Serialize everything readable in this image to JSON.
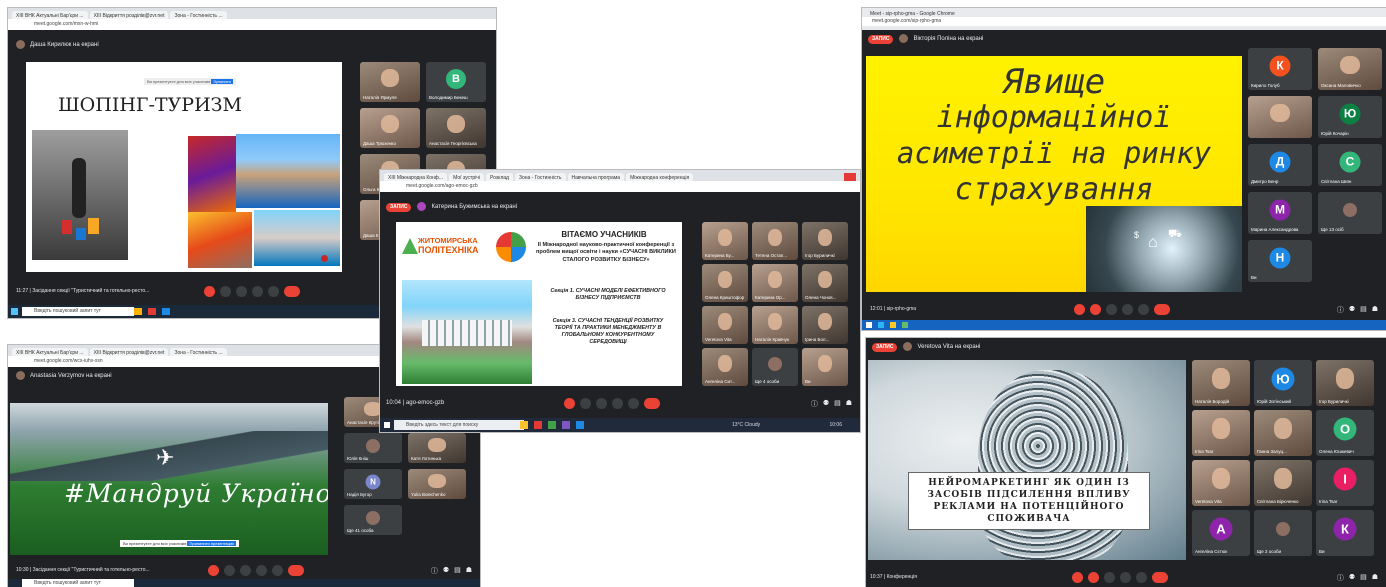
{
  "shots": {
    "s1": {
      "tabs": [
        "XIII ВНК Актуальні Бар'єри ...",
        "XIII Відкриття розділів@zvr.net",
        "Зона - Гостинність ..."
      ],
      "url": "meet.google.com/mxn-w-hmi",
      "presenter": "Даша Кирилюк на екрані",
      "slide_title": "ШОПІНГ-ТУРИЗМ",
      "slide_topbar": "Ви презентуєте для всіх учасників",
      "slide_topbtn": "Зупинити",
      "tiles": [
        {
          "name": "Наталія Ярмуля",
          "kind": "cam"
        },
        {
          "name": "Володимир Бекеш",
          "kind": "avatar",
          "letter": "B",
          "color": "#33b679"
        },
        {
          "name": "Даша Трюхенко",
          "kind": "cam2"
        },
        {
          "name": "Анастасія Георгієвська",
          "kind": "cam3"
        },
        {
          "name": "Ольга Кравчук",
          "kind": "cam"
        },
        {
          "name": "",
          "kind": "cam3"
        },
        {
          "name": "Даша К",
          "kind": "cam2"
        }
      ],
      "time_meeting": "11:27 | Засідання секції \"Туристичний та готельно-ресто...",
      "search_text": "Введіть пошуковий запит тут"
    },
    "s2": {
      "tabs": [
        "XIII ВНК Актуальні Бар'єри ...",
        "XIII Відкриття розділів@zvr.net",
        "Зона - Гостинність ..."
      ],
      "url": "meet.google.com/wcs-iuhv-xsn",
      "presenter": "Anastasia Verzymov на екрані",
      "slide_text": "#Мандруй Україною",
      "slide_topbar": "Ви презентуєте для всіх учасників",
      "slide_topbtn": "Припинити презентацію",
      "tiles": [
        {
          "name": "Анастасія Круті...",
          "kind": "cam"
        },
        {
          "name": "Ангеліна Кашпарук",
          "kind": "cam2"
        },
        {
          "name": "Юлія Кніш",
          "kind": "avatar",
          "letter": "",
          "color": "#5f6368"
        },
        {
          "name": "Катя Лотинька",
          "kind": "cam3"
        },
        {
          "name": "Надія Бугор",
          "kind": "avatar",
          "letter": "N",
          "color": "#7986cb"
        },
        {
          "name": "Yulia Boiechenko",
          "kind": "cam"
        },
        {
          "name": "Ще 41 особа",
          "kind": "avatar",
          "letter": "",
          "color": "#5f6368"
        }
      ],
      "time_meeting": "10:30 | Засідання секції \"Туристичний та готельно-ресто...",
      "search_text": "Введіть пошуковий запит тут"
    },
    "s3": {
      "tabs": [
        "XIII Міжнародна Конф...",
        "Мої зустрічі",
        "Розклад",
        "Зона - Гостинність",
        "Навчальна програма",
        "Міжнародна конференція"
      ],
      "url": "meet.google.com/ago-emoc-gzb",
      "record_label": "ЗАПИС",
      "presenter": "Катерина Бужимська на екрані",
      "slide_logo_line1": "ЖИТОМИРСЬКА",
      "slide_logo_line2": "ПОЛІТЕХНІКА",
      "slide_heading": "ВІТАЄМО УЧАСНИКІВ",
      "slide_sub": "ІІ Міжнародної науково-практичної конференції з проблем вищої освіти і науки «СУЧАСНІ ВИКЛИКИ СТАЛОГО РОЗВИТКУ БІЗНЕСУ»",
      "slide_sec1": "Секція 1. СУЧАСНІ МОДЕЛІ ЕФЕКТИВНОГО БІЗНЕСУ ПІДПРИЄМСТВ",
      "slide_sec3": "Секція 3. СУЧАСНІ ТЕНДЕНЦІЇ РОЗВИТКУ ТЕОРІЇ ТА ПРАКТИКИ МЕНЕДЖМЕНТУ В ГЛОБАЛЬНОМУ КОНКУРЕНТНОМУ СЕРЕДОВИЩІ",
      "tiles": [
        {
          "name": "Катерина Бу...",
          "kind": "cam2"
        },
        {
          "name": "Тетяна Остап...",
          "kind": "cam"
        },
        {
          "name": "Ігор Буриличкі",
          "kind": "cam3"
        },
        {
          "name": "Олена Криштофор",
          "kind": "cam"
        },
        {
          "name": "Катерина Ор...",
          "kind": "cam2"
        },
        {
          "name": "Олена Чонов...",
          "kind": "cam3"
        },
        {
          "name": "Veretova Vita",
          "kind": "cam"
        },
        {
          "name": "Наталія Кравчук",
          "kind": "cam2"
        },
        {
          "name": "Ірина Бол...",
          "kind": "cam3"
        },
        {
          "name": "Ангеліна Сит...",
          "kind": "cam"
        },
        {
          "name": "Ще 4 особи",
          "kind": "avatar",
          "letter": "",
          "color": "#5f6368"
        },
        {
          "name": "Ви",
          "kind": "cam2"
        }
      ],
      "time_meeting": "10:04 | ago-emoc-gzb",
      "search_text": "Введіть здесь текст для поиску",
      "weather": "13°C Cloudy",
      "clock": "10:06"
    },
    "s4": {
      "tabs": [
        "Meet - sip-rpho-gma - Google Chrome"
      ],
      "url": "meet.google.com/sip-rpho-gma",
      "record_label": "ЗАПИС",
      "presenter": "Вікторія Поліна на екрані",
      "slide_text_l1": "Явище",
      "slide_text_l2": "інформаційної",
      "slide_text_l3": "асиметрії на ринку",
      "slide_text_l4": "страхування",
      "tiles": [
        {
          "name": "Кирило Голуб",
          "kind": "avatar",
          "letter": "К",
          "color": "#f4511e"
        },
        {
          "name": "Оксана Маловичко",
          "kind": "cam"
        },
        {
          "name": "",
          "kind": "cam2"
        },
        {
          "name": "Юрій Кочарін",
          "kind": "avatar",
          "letter": "Ю",
          "color": "#0b8043"
        },
        {
          "name": "Дмитро Бенр",
          "kind": "avatar",
          "letter": "Д",
          "color": "#1e88e5"
        },
        {
          "name": "Світлана Шиїн",
          "kind": "avatar",
          "letter": "С",
          "color": "#33b679"
        },
        {
          "name": "Марина Александрова",
          "kind": "avatar",
          "letter": "М",
          "color": "#8e24aa"
        },
        {
          "name": "Ще 13 осіб",
          "kind": "avatar",
          "letter": "",
          "color": "#5f6368"
        },
        {
          "name": "Ви",
          "kind": "avatar",
          "letter": "Н",
          "color": "#1e88e5"
        }
      ],
      "time_meeting": "12:01 | sip-rpho-gma"
    },
    "s5": {
      "record_label": "ЗАПИС",
      "presenter": "Veretova Vita на екрані",
      "slide_caption": "НЕЙРОМАРКЕТИНГ ЯК ОДИН ІЗ ЗАСОБІВ ПІДСИЛЕННЯ ВПЛИВУ РЕКЛАМИ НА ПОТЕНЦІЙНОГО СПОЖИВАЧА",
      "tiles": [
        {
          "name": "Наталія Бородій",
          "kind": "cam"
        },
        {
          "name": "Юрій Зотінський",
          "kind": "avatar",
          "letter": "Ю",
          "color": "#1e88e5"
        },
        {
          "name": "Ігор Буриличкі",
          "kind": "cam3"
        },
        {
          "name": "Irina Tsar",
          "kind": "cam2"
        },
        {
          "name": "Ганна Залуц...",
          "kind": "cam"
        },
        {
          "name": "Олена Юшкевич",
          "kind": "avatar",
          "letter": "О",
          "color": "#33b679"
        },
        {
          "name": "Veretova Vita",
          "kind": "cam2"
        },
        {
          "name": "Світлана Бірюченко",
          "kind": "cam3"
        },
        {
          "name": "Irina Tsar",
          "kind": "avatar",
          "letter": "I",
          "color": "#e91e63"
        },
        {
          "name": "Ангеліна Сєтюк",
          "kind": "avatar",
          "letter": "А",
          "color": "#8e24aa"
        },
        {
          "name": "Ще 2 особи",
          "kind": "avatar",
          "letter": "",
          "color": "#5f6368"
        },
        {
          "name": "Ви",
          "kind": "avatar",
          "letter": "К",
          "color": "#8e24aa"
        }
      ],
      "time_meeting": "10:37 | Конференція"
    }
  }
}
